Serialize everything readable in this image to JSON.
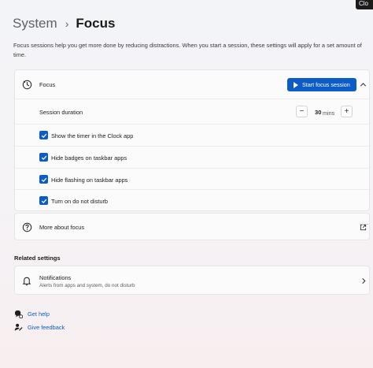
{
  "corner_label": "Clo",
  "breadcrumb": {
    "parent": "System",
    "separator": "›",
    "current": "Focus"
  },
  "description": "Focus sessions help you get more done by reducing distractions. When you start a session, these settings will apply for a set amount of time.",
  "focus": {
    "title": "Focus",
    "start_button": "Start focus session",
    "duration_label": "Session duration",
    "duration_value": "30",
    "duration_unit": "mins",
    "decrement": "−",
    "increment": "+",
    "options": [
      {
        "label": "Show the timer in the Clock app",
        "checked": true
      },
      {
        "label": "Hide badges on taskbar apps",
        "checked": true
      },
      {
        "label": "Hide flashing on taskbar apps",
        "checked": true
      },
      {
        "label": "Turn on do not disturb",
        "checked": true
      }
    ]
  },
  "more_about": {
    "label": "More about focus"
  },
  "related": {
    "title": "Related settings",
    "notifications": {
      "title": "Notifications",
      "subtitle": "Alerts from apps and system, do not disturb"
    }
  },
  "footer": {
    "get_help": "Get help",
    "give_feedback": "Give feedback"
  },
  "colors": {
    "accent": "#0b5cc7",
    "link": "#0a5ec2"
  }
}
